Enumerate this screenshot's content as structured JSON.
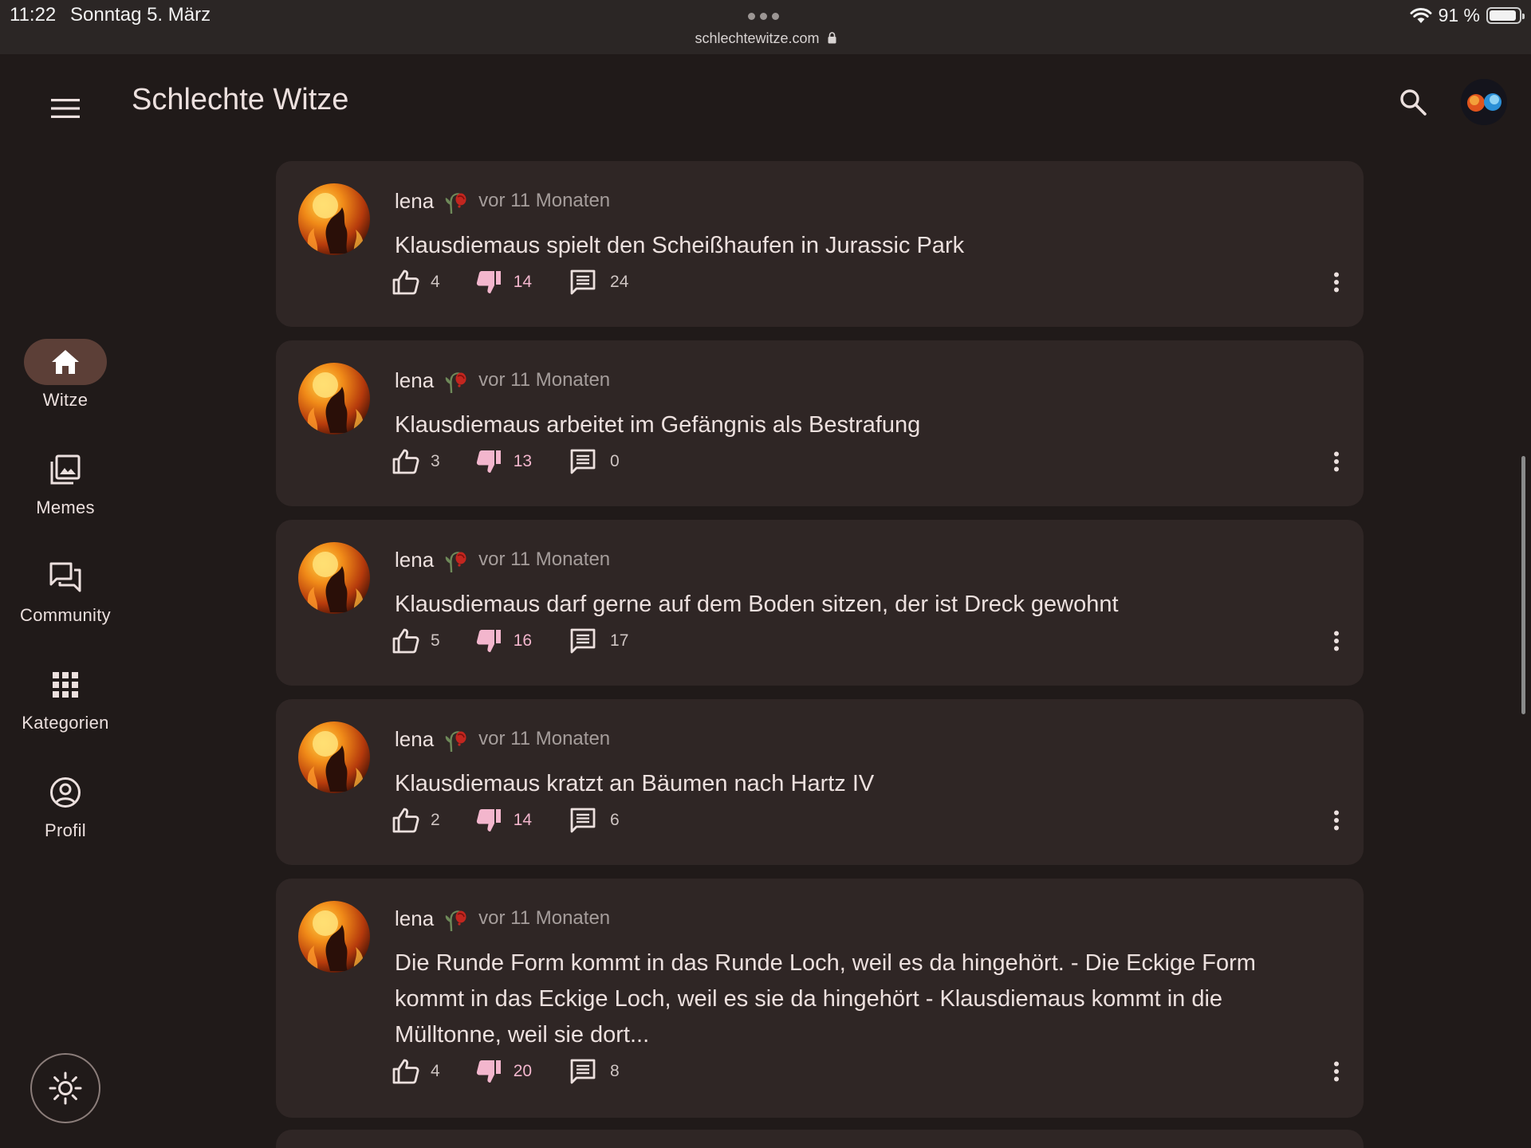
{
  "status_bar": {
    "time": "11:22",
    "date": "Sonntag 5. März",
    "url": "schlechtewitze.com",
    "battery": "91 %",
    "battery_level": 0.91
  },
  "app_bar": {
    "title": "Schlechte Witze",
    "menu_icon": "menu-icon",
    "search_icon": "search-icon"
  },
  "nav": {
    "items": [
      {
        "label": "Witze",
        "icon": "home-icon",
        "active": true
      },
      {
        "label": "Memes",
        "icon": "image-library-icon",
        "active": false
      },
      {
        "label": "Community",
        "icon": "forum-icon",
        "active": false
      },
      {
        "label": "Kategorien",
        "icon": "apps-grid-icon",
        "active": false
      },
      {
        "label": "Profil",
        "icon": "account-circle-icon",
        "active": false
      }
    ],
    "theme_icon": "sun-icon"
  },
  "posts": [
    {
      "author": "lena",
      "time": "vor 11 Monaten",
      "text": "Klausdiemaus spielt den Scheißhaufen in Jurassic Park",
      "likes": "4",
      "dislikes": "14",
      "comments": "24"
    },
    {
      "author": "lena",
      "time": "vor 11 Monaten",
      "text": "Klausdiemaus arbeitet im Gefängnis als Bestrafung",
      "likes": "3",
      "dislikes": "13",
      "comments": "0"
    },
    {
      "author": "lena",
      "time": "vor 11 Monaten",
      "text": "Klausdiemaus darf gerne auf dem Boden sitzen, der ist Dreck gewohnt",
      "likes": "5",
      "dislikes": "16",
      "comments": "17"
    },
    {
      "author": "lena",
      "time": "vor 11 Monaten",
      "text": "Klausdiemaus kratzt an Bäumen nach Hartz IV",
      "likes": "2",
      "dislikes": "14",
      "comments": "6"
    },
    {
      "author": "lena",
      "time": "vor 11 Monaten",
      "text": "Die Runde Form kommt in das Runde Loch, weil es da hingehört. - Die Eckige Form kommt in das Eckige Loch, weil es sie da hingehört - Klausdiemaus kommt in die Mülltonne, weil sie dort...",
      "likes": "4",
      "dislikes": "20",
      "comments": "8"
    }
  ],
  "colors": {
    "background": "#201a19",
    "card": "#2f2625",
    "active_pill": "#5c3f37",
    "dislike": "#f3b6cd",
    "secondary_text": "#a59d9b"
  }
}
